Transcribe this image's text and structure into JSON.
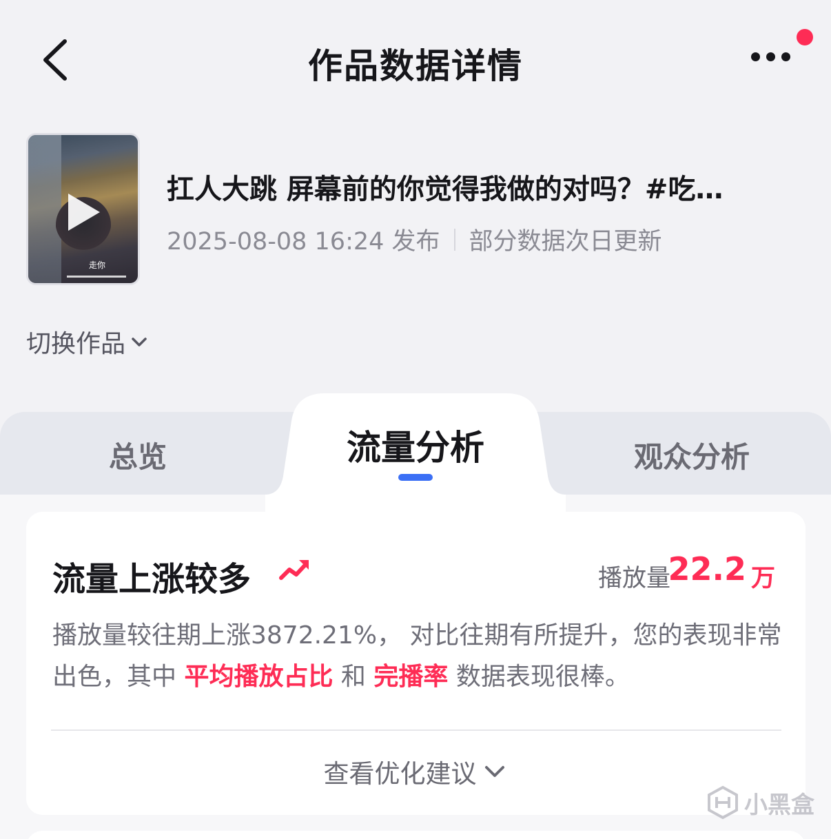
{
  "header": {
    "title": "作品数据详情"
  },
  "video": {
    "title": "扛人大跳 屏幕前的你觉得我做的对吗？#吃…",
    "publish_time": "2025-08-08 16:24 发布",
    "update_note": "部分数据次日更新",
    "thumbnail_caption": "走你"
  },
  "switch_work": {
    "label": "切换作品"
  },
  "tabs": [
    {
      "label": "总览",
      "active": false
    },
    {
      "label": "流量分析",
      "active": true
    },
    {
      "label": "观众分析",
      "active": false
    }
  ],
  "traffic_card": {
    "title": "流量上涨较多",
    "play_label": "播放量",
    "play_value": "22.2",
    "play_unit": "万",
    "desc_part1": "播放量较往期上涨3872.21%， 对比往期有所提升，您的表现非常出色，其中 ",
    "highlight1": "平均播放占比",
    "desc_part2": " 和 ",
    "highlight2": "完播率",
    "desc_part3": " 数据表现很棒。",
    "advice_label": "查看优化建议"
  },
  "watermark": {
    "text": "小黑盒"
  },
  "colors": {
    "accent_red": "#fe2c55",
    "tab_indicator": "#3b6ff5"
  }
}
